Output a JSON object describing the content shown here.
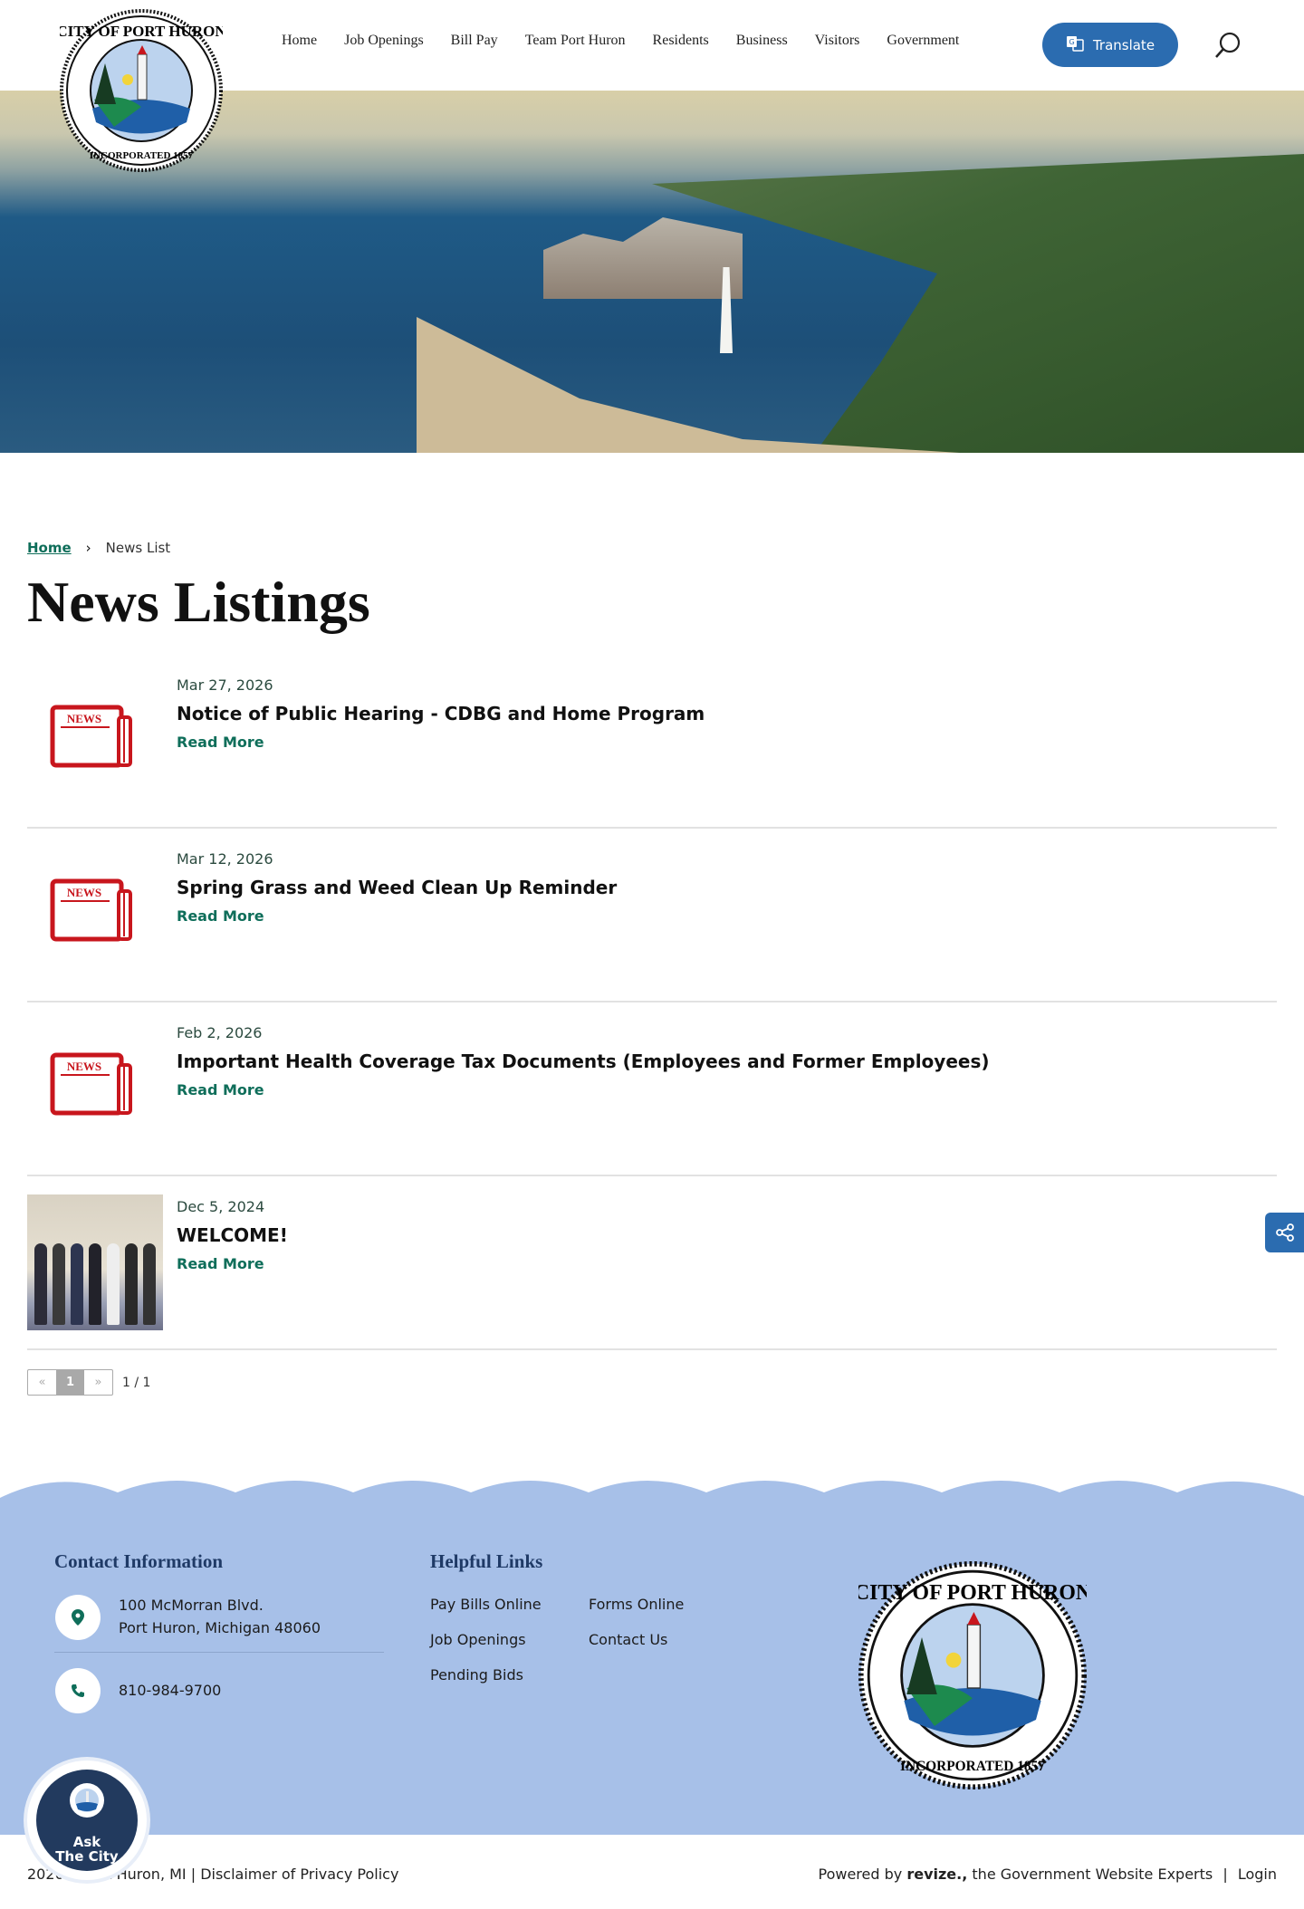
{
  "header": {
    "logo_text": "City of Port Huron - Incorporated 1857",
    "nav": [
      "Home",
      "Job Openings",
      "Bill Pay",
      "Team Port Huron",
      "Residents",
      "Business",
      "Visitors",
      "Government"
    ],
    "translate_label": "Translate"
  },
  "breadcrumb": {
    "home": "Home",
    "current": "News List"
  },
  "page_title": "News Listings",
  "news": [
    {
      "date": "Mar 27, 2026",
      "title": "Notice of Public Hearing - CDBG and Home Program",
      "link": "Read More",
      "thumb": "news-icon"
    },
    {
      "date": "Mar 12, 2026",
      "title": "Spring Grass and Weed Clean Up Reminder",
      "link": "Read More",
      "thumb": "news-icon"
    },
    {
      "date": "Feb 2, 2026",
      "title": "Important Health Coverage Tax Documents (Employees and Former Employees)",
      "link": "Read More",
      "thumb": "news-icon"
    },
    {
      "date": "Dec 5, 2024",
      "title": "WELCOME!",
      "link": "Read More",
      "thumb": "photo"
    }
  ],
  "pagination": {
    "prev": "«",
    "page": "1",
    "next": "»",
    "summary": "1 / 1"
  },
  "footer": {
    "contact_heading": "Contact Information",
    "address_line1": "100 McMorran Blvd.",
    "address_line2": "Port Huron, Michigan 48060",
    "phone": "810-984-9700",
    "links_heading": "Helpful Links",
    "links": [
      "Pay Bills Online",
      "Job Openings",
      "Pending Bids",
      "Forms Online",
      "Contact Us"
    ],
    "copyright": "2026© Port Huron, MI | Disclaimer of Privacy Policy",
    "powered_prefix": "Powered by ",
    "powered_brand": "revize.,",
    "powered_suffix": " the Government Website Experts",
    "login": "Login"
  },
  "ask_widget": {
    "line1": "Ask",
    "line2": "The City"
  },
  "colors": {
    "accent": "#0f6e5a",
    "nav_blue": "#2b6cb0",
    "footer_bg": "#a7c0e8",
    "heading_navy": "#1f3a66",
    "news_red": "#c8161d"
  }
}
